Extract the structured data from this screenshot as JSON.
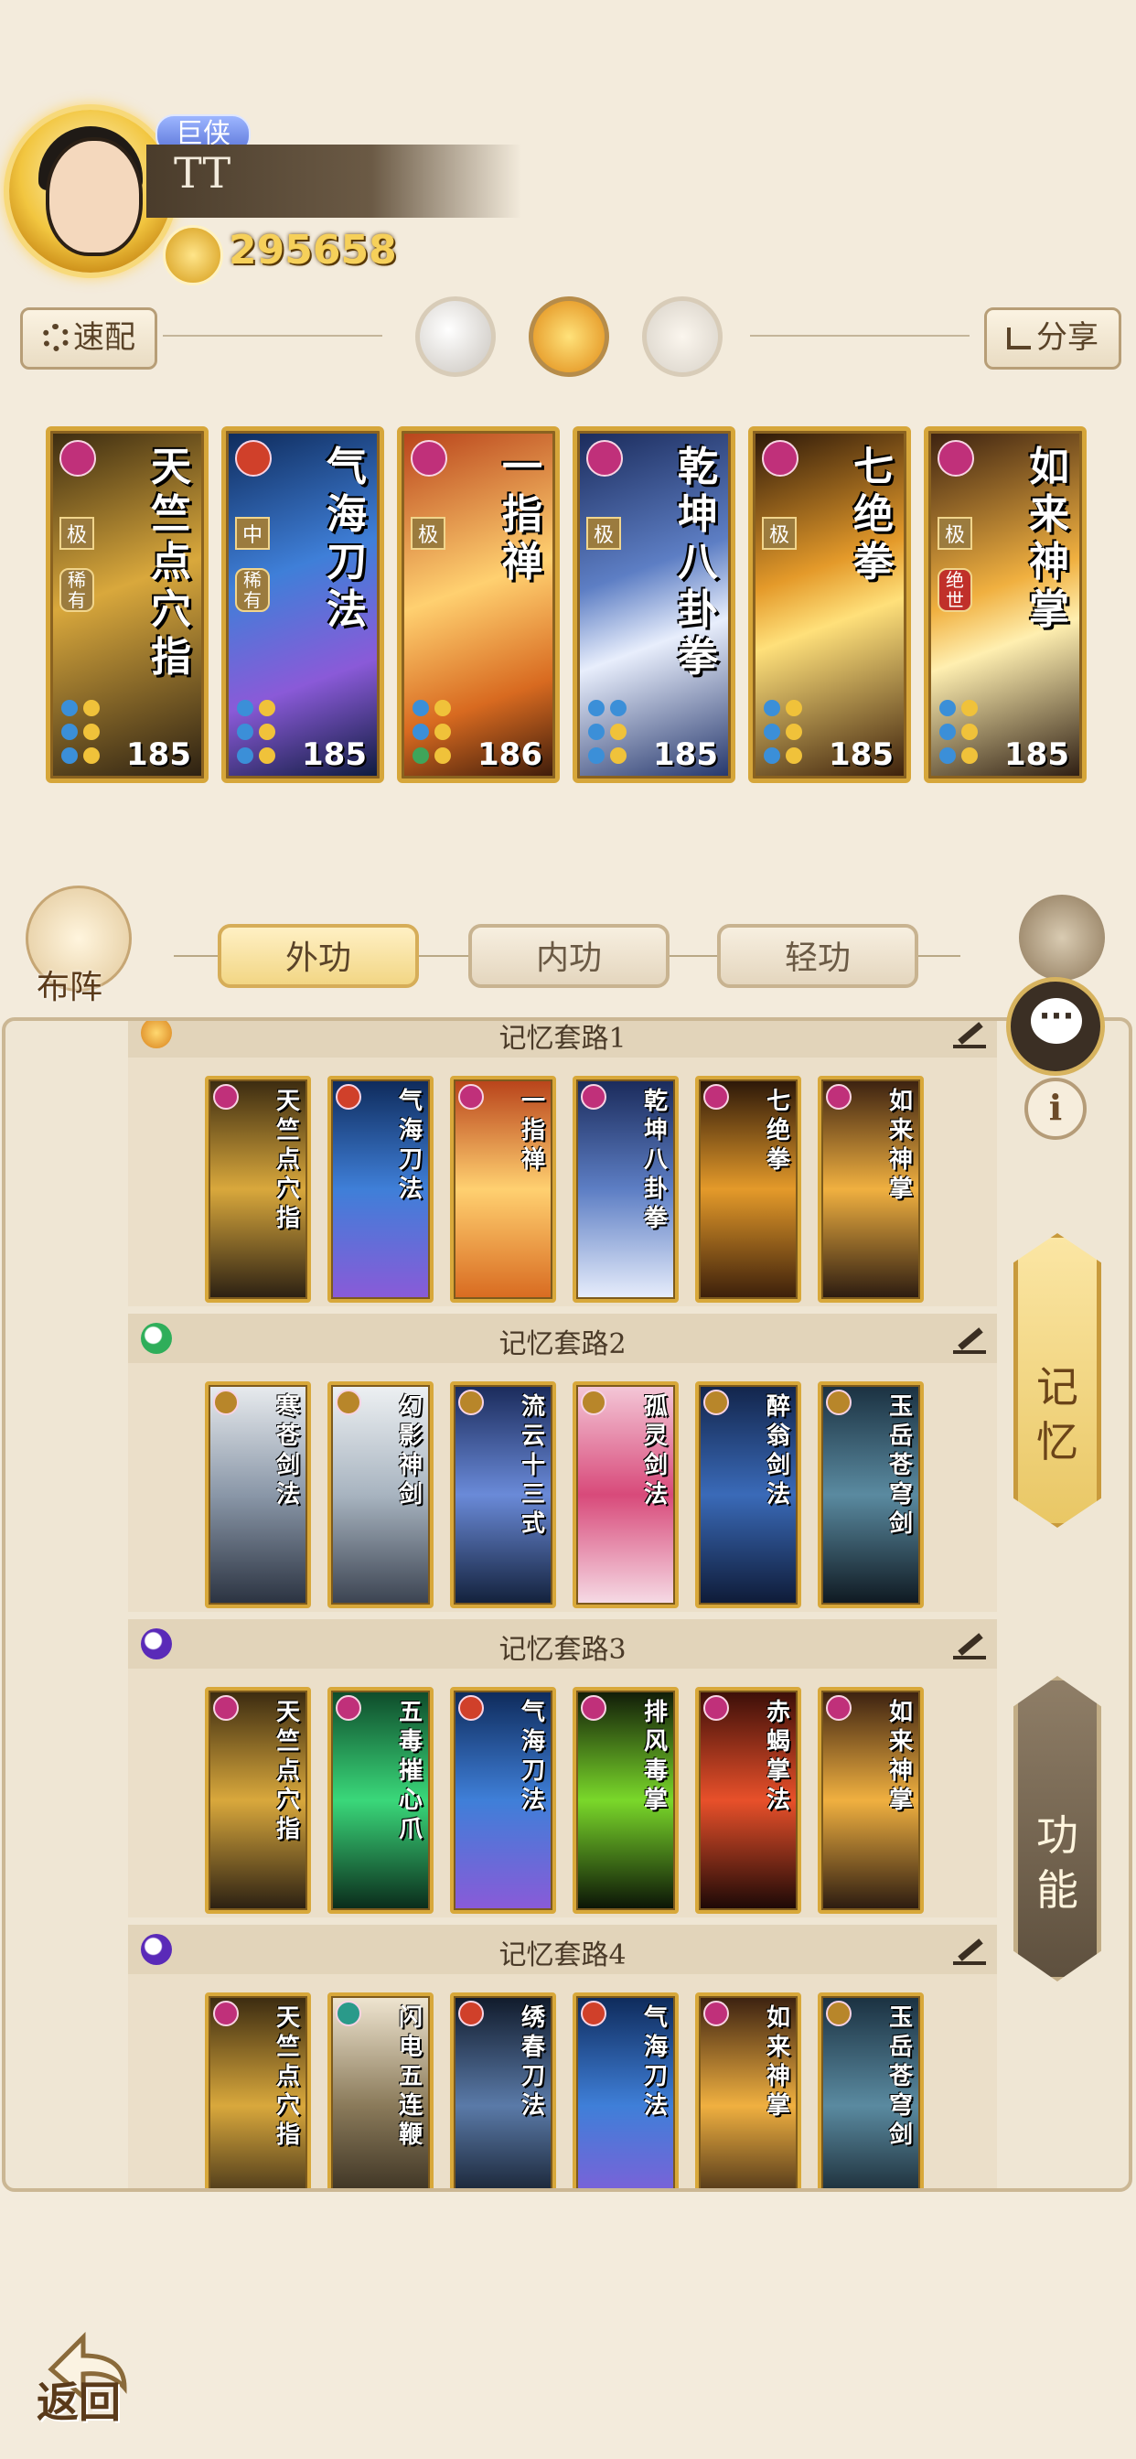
{
  "player": {
    "title_badge": "巨侠",
    "name": "TT",
    "power": "295658"
  },
  "top_buttons": {
    "quick_config": "速配",
    "share": "分享"
  },
  "equipped_cards": [
    {
      "name": "天竺点穴指",
      "level": "185",
      "grade": "极",
      "rarity": "稀有"
    },
    {
      "name": "气海刀法",
      "level": "185",
      "grade": "中",
      "rarity": "稀有"
    },
    {
      "name": "一指禅",
      "level": "186",
      "grade": "极",
      "rarity": ""
    },
    {
      "name": "乾坤八卦拳",
      "level": "185",
      "grade": "极",
      "rarity": ""
    },
    {
      "name": "七绝拳",
      "level": "185",
      "grade": "极",
      "rarity": ""
    },
    {
      "name": "如来神掌",
      "level": "185",
      "grade": "极",
      "rarity": "绝世"
    }
  ],
  "formation_label": "布阵",
  "tabs": [
    "外功",
    "内功",
    "轻功"
  ],
  "memory_sets": [
    {
      "title": "记忆套路1",
      "cards": [
        "天竺点穴指",
        "气海刀法",
        "一指禅",
        "乾坤八卦拳",
        "七绝拳",
        "如来神掌"
      ]
    },
    {
      "title": "记忆套路2",
      "cards": [
        "寒苍剑法",
        "幻影神剑",
        "流云十三式",
        "孤灵剑法",
        "醉翁剑法",
        "玉岳苍穹剑"
      ]
    },
    {
      "title": "记忆套路3",
      "cards": [
        "天竺点穴指",
        "五毒摧心爪",
        "气海刀法",
        "排风毒掌",
        "赤蝎掌法",
        "如来神掌"
      ]
    },
    {
      "title": "记忆套路4",
      "cards": [
        "天竺点穴指",
        "闪电五连鞭",
        "绣春刀法",
        "气海刀法",
        "如来神掌",
        "玉岳苍穹剑"
      ]
    }
  ],
  "side_buttons": {
    "memory": "记忆",
    "function": "功能",
    "info": "i"
  },
  "back_label": "返回",
  "colors": {
    "gold_border": "#d6a63a",
    "panel_bg": "#efe6d4",
    "page_bg": "#f3ebdc",
    "tag_magenta": "#c0307a"
  }
}
